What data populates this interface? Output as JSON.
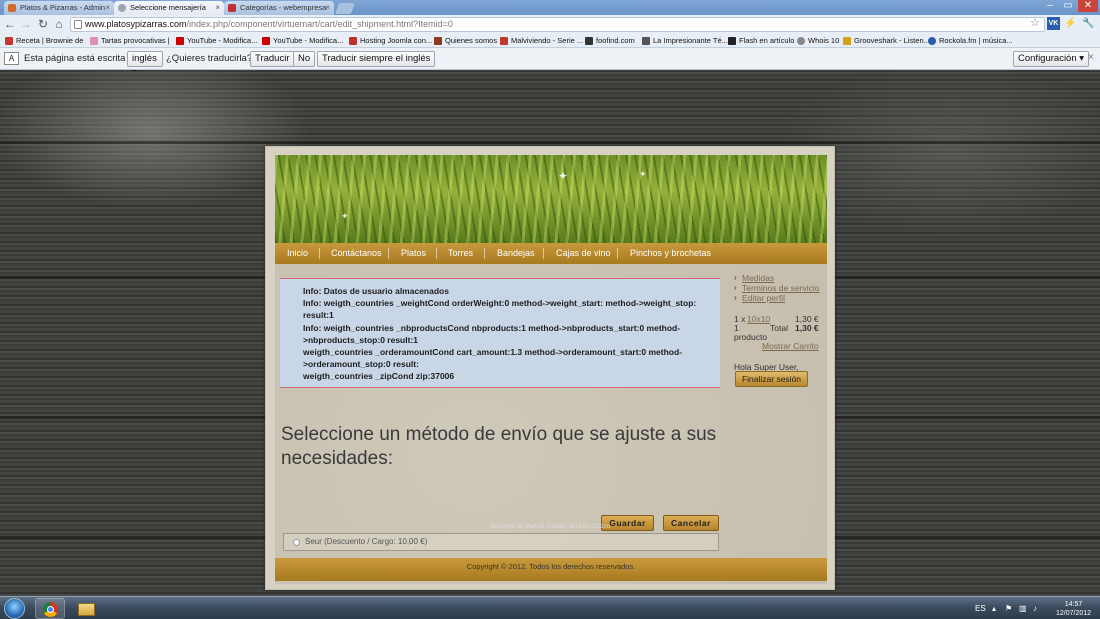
{
  "browser": {
    "tabs": [
      {
        "label": "Platos & Pizarras - Admin",
        "active": false,
        "favicon_color": "#d26a2a"
      },
      {
        "label": "Seleccione mensajería",
        "active": true,
        "favicon_color": "#9aa6b4"
      },
      {
        "label": "Categorías - webempresa",
        "active": false,
        "favicon_color": "#c03030"
      }
    ],
    "window_controls": {
      "minimize": "–",
      "maximize": "▭",
      "close": "✕"
    },
    "url_host": "www.platosypizarras.com",
    "url_path": "/index.php/component/virtuemart/cart/edit_shipment.html?Itemid=0",
    "bookmarks": [
      {
        "label": "Receta | Brownie de",
        "color": "#c0392b"
      },
      {
        "label": "Tartas provocativas |",
        "color": "#e08fb0"
      },
      {
        "label": "YouTube - Modifica...",
        "color": "#cc0000"
      },
      {
        "label": "YouTube - Modifica...",
        "color": "#cc0000"
      },
      {
        "label": "Hosting Joomla con...",
        "color": "#c03030"
      },
      {
        "label": "Quienes somos",
        "color": "#8b3a1a"
      },
      {
        "label": "Malviviendo - Serie ...",
        "color": "#c0392b"
      },
      {
        "label": "foofind.com",
        "color": "#333333"
      },
      {
        "label": "La Impresionante Té...",
        "color": "#555555"
      },
      {
        "label": "Flash en artículo",
        "color": "#222222"
      },
      {
        "label": "Whois 10",
        "color": "#888888"
      },
      {
        "label": "Grooveshark - Listen...",
        "color": "#d4a017"
      },
      {
        "label": "Rockola.fm | música...",
        "color": "#2a5db0"
      }
    ]
  },
  "translate_bar": {
    "text": "Esta página está escrita en",
    "language": "inglés",
    "question": "¿Quieres traducirla?",
    "translate": "Traducir",
    "no": "No",
    "always": "Traducir siempre el inglés",
    "config": "Configuración"
  },
  "site": {
    "nav": [
      "Inicio",
      "Contáctanos",
      "Platos",
      "Torres",
      "Bandejas",
      "Cajas de vino",
      "Pinchos y brochetas"
    ],
    "info_lines": [
      "Info: Datos de usuario almacenados",
      "Info: weigth_countries _weightCond orderWeight:0 method->weight_start: method->weight_stop:",
      "result:1",
      "Info: weigth_countries _nbproductsCond nbproducts:1 method->nbproducts_start:0 method-",
      ">nbproducts_stop:0 result:1",
      "weigth_countries _orderamountCond cart_amount:1.3 method->orderamount_start:0 method-",
      ">orderamount_stop:0 result:",
      "weigth_countries _zipCond zip:37006"
    ],
    "sidebar_links": [
      "Medidas",
      "Terminos de servicio",
      "Editar perfil"
    ],
    "cart": {
      "line1_qty": "1 x",
      "line1_item": "10x10",
      "line1_price": "1,30 €",
      "line2_qty": "1",
      "line2_label": "Total",
      "line2_total": "1,30 €",
      "line3": "producto",
      "show_cart": "Mostrar Carrito"
    },
    "greeting": "Hola Super User,",
    "logout": "Finalizar sesión",
    "heading": "Seleccione un método de envío que se ajuste a sus necesidades:",
    "save": "Guardar",
    "cancel": "Cancelar",
    "shipping_option": "Seur  (Descuento / Cargo: 10,00 €)",
    "copyright": "Copyright © 2012. Todos los derechos reservados.",
    "designed_by": "Designed by Manuel Carbajo del Saz-Orozco"
  },
  "taskbar": {
    "lang": "ES",
    "time": "14:57",
    "date": "12/07/2012"
  }
}
